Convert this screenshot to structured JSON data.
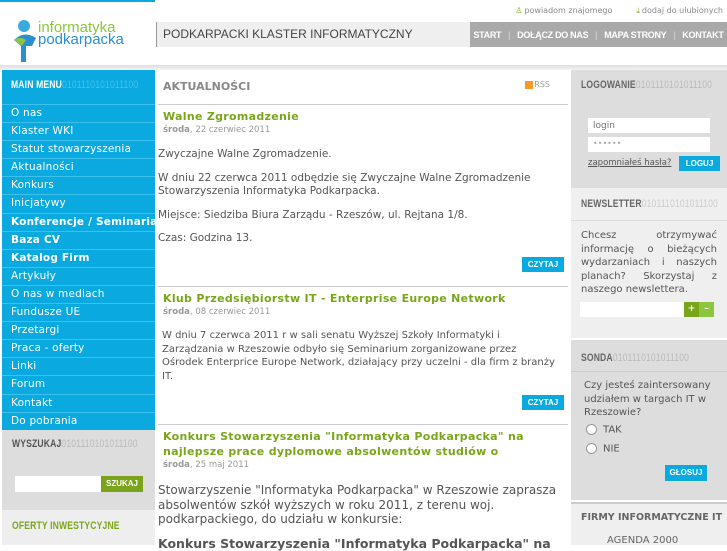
{
  "header": {
    "logo_line1": "informatyka",
    "logo_line2": "podkarpacka",
    "title": "PODKARPACKI KLASTER INFORMATYCZNY",
    "toplinks": [
      {
        "label": "powiadom znajomego",
        "icon": "user-icon"
      },
      {
        "label": "dodaj do ulubionych",
        "icon": "download-icon"
      }
    ],
    "nav": [
      "START",
      "DOŁĄCZ DO NAS",
      "MAPA STRONY",
      "KONTAKT"
    ]
  },
  "left": {
    "menu_title": "MAIN MENU",
    "binary": "0101110101011100",
    "menu": [
      {
        "label": "O nas",
        "bold": false
      },
      {
        "label": "Klaster WKI",
        "bold": false
      },
      {
        "label": "Statut stowarzyszenia",
        "bold": false
      },
      {
        "label": "Aktualności",
        "bold": false
      },
      {
        "label": "Konkurs",
        "bold": false
      },
      {
        "label": "Inicjatywy",
        "bold": false
      },
      {
        "label": "Konferencje / Seminaria",
        "bold": true
      },
      {
        "label": "Baza CV",
        "bold": true
      },
      {
        "label": "Katalog Firm",
        "bold": true
      },
      {
        "label": "Artykuły",
        "bold": false
      },
      {
        "label": "O nas w mediach",
        "bold": false
      },
      {
        "label": "Fundusze UE",
        "bold": false
      },
      {
        "label": "Przetargi",
        "bold": false
      },
      {
        "label": "Praca - oferty",
        "bold": false
      },
      {
        "label": "Linki",
        "bold": false
      },
      {
        "label": "Forum",
        "bold": false
      },
      {
        "label": "Kontakt",
        "bold": false
      },
      {
        "label": "Do pobrania",
        "bold": false
      }
    ],
    "search_title": "WYSZUKAJ",
    "search_button": "SZUKAJ",
    "offers_title": "OFERTY INWESTYCYJNE"
  },
  "center": {
    "title": "AKTUALNOŚCI",
    "rss": "RSS",
    "read_label": "CZYTAJ",
    "articles": [
      {
        "title": "Walne Zgromadzenie",
        "day": "środa",
        "date": ", 22 czerwiec 2011",
        "paragraphs": [
          "Zwyczajne Walne Zgromadzenie.",
          "W dniu 22 czerwca 2011 odbędzie się Zwyczajne Walne Zgromadzenie Stowarzyszenia Informatyka Podkarpacka.",
          "Miejsce: Siedziba Biura Zarządu - Rzeszów, ul. Rejtana 1/8.",
          "Czas: Godzina 13."
        ]
      },
      {
        "title": "Klub Przedsiębiorstw IT - Enterprise Europe Network",
        "day": "środa",
        "date": ", 08 czerwiec 2011",
        "paragraphs": [
          "W dniu 7 czerwca 2011 r w sali senatu Wyższej Szkoły Informatyki i Zarządzania w Rzeszowie odbyło się Seminarium zorganizowane przez Ośrodek Enterprice Europe Network, działający przy uczelni -  dla firm z branży IT."
        ]
      },
      {
        "title": "Konkurs Stowarzyszenia \"Informatyka Podkarpacka\" na najlepsze prace dyplomowe absolwentów studiów o",
        "day": "środa",
        "date": ", 25 maj 2011",
        "paragraphs": [
          "Stowarzyszenie \"Informatyka Podkarpacka\" w Rzeszowie zaprasza absolwentów szkół wyższych w roku 2011, z terenu woj. podkarpackiego, do udziału w konkursie:",
          "Konkurs Stowarzyszenia \"Informatyka Podkarpacka\" na"
        ]
      }
    ]
  },
  "right": {
    "login_title": "LOGOWANIE",
    "login_placeholder": "login",
    "password_value": "••••••",
    "forgot": "zapomniałeś hasła?",
    "login_button": "LOGUJ",
    "newsletter_title": "NEWSLETTER",
    "newsletter_text": "Chcesz otrzymywać informację o bieżących wydarzaniach i naszych planach? Skorzystaj z naszego newslettera.",
    "plus": "+",
    "minus": "–",
    "poll_title": "SONDA",
    "poll_question": "Czy jesteś zaintersowany udziałem w targach IT w Rzeszowie?",
    "poll_options": [
      "TAK",
      "NIE"
    ],
    "vote_button": "GŁOSUJ",
    "firms_title": "FIRMY INFORMATYCZNE IT",
    "firms_item": "AGENDA 2000"
  }
}
